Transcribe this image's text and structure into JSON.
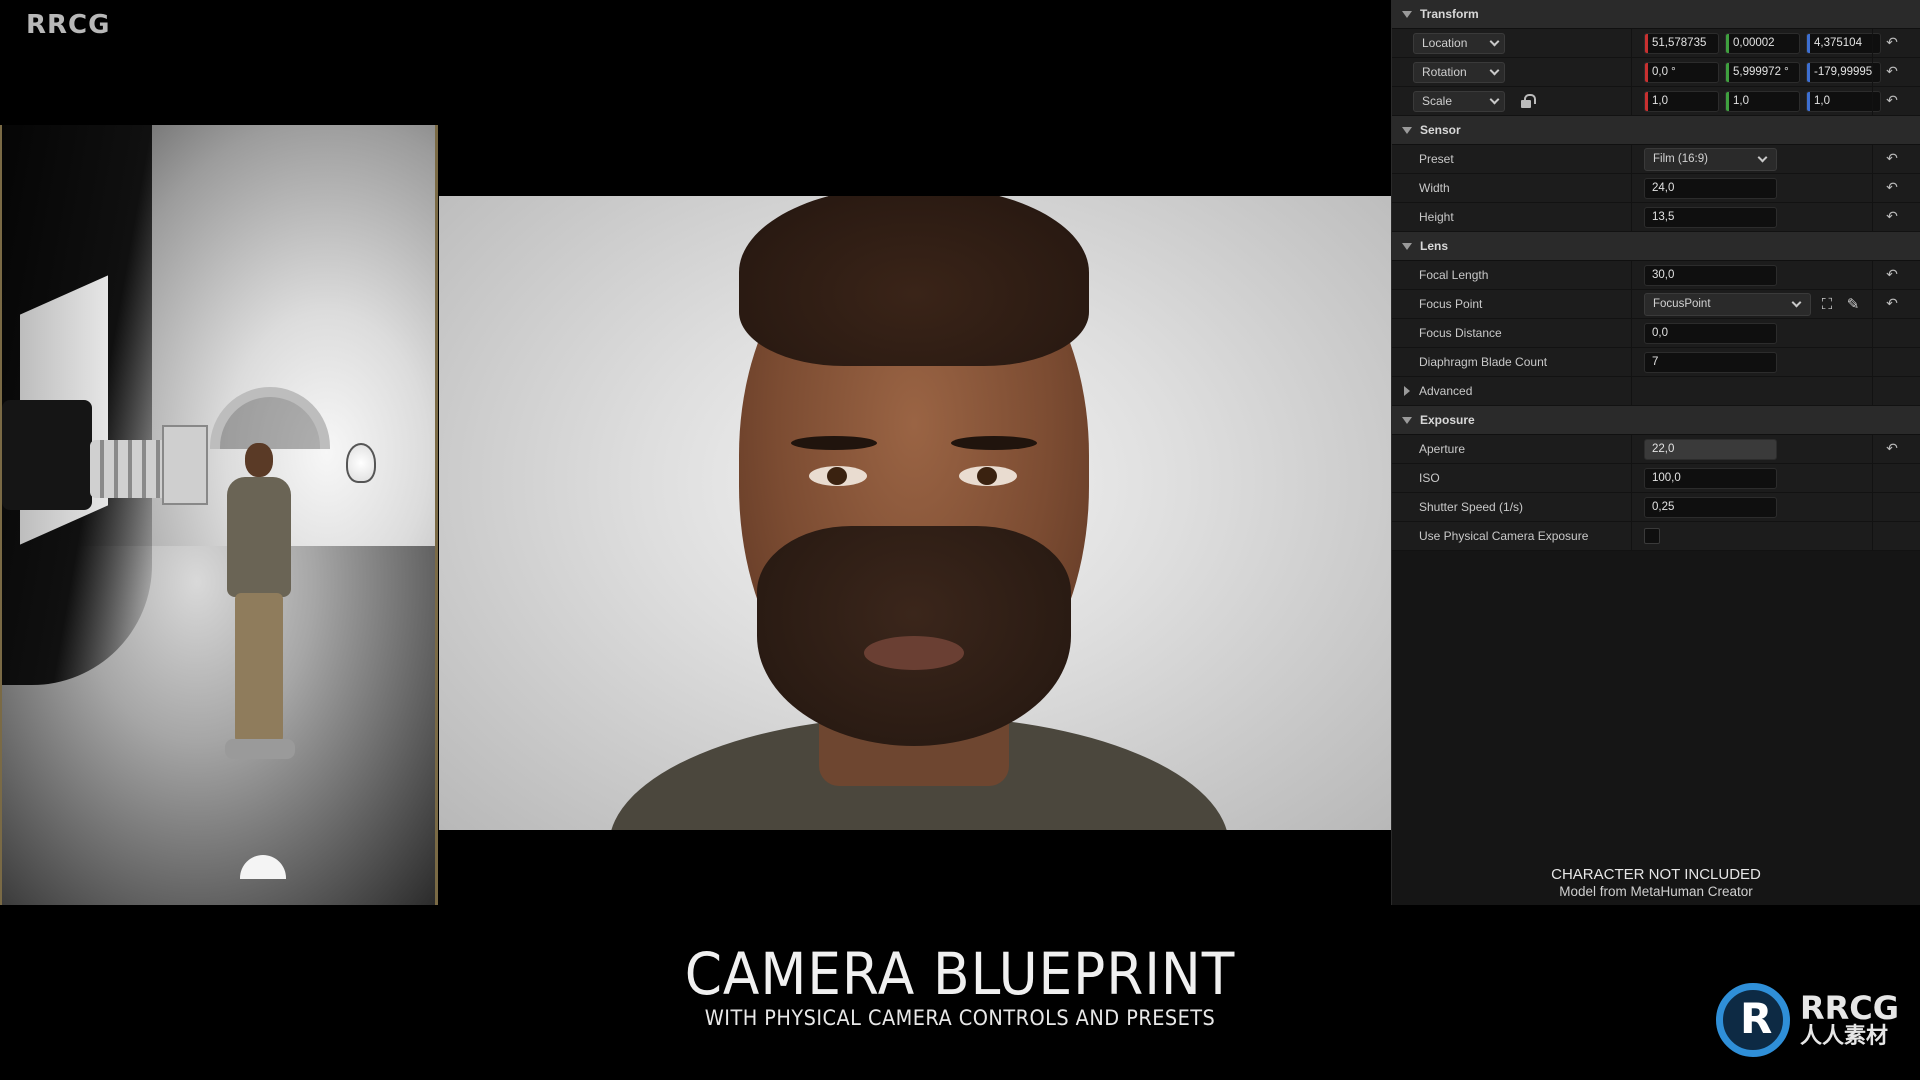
{
  "corner_logo": "RRCG",
  "details": {
    "transform": {
      "title": "Transform",
      "location": {
        "label": "Location",
        "x": "51,578735",
        "y": "0,00002",
        "z": "4,375104"
      },
      "rotation": {
        "label": "Rotation",
        "x": "0,0 °",
        "y": "5,999972 °",
        "z": "-179,99995"
      },
      "scale": {
        "label": "Scale",
        "x": "1,0",
        "y": "1,0",
        "z": "1,0"
      }
    },
    "sensor": {
      "title": "Sensor",
      "preset_label": "Preset",
      "preset_value": "Film (16:9)",
      "width_label": "Width",
      "width_value": "24,0",
      "height_label": "Height",
      "height_value": "13,5"
    },
    "lens": {
      "title": "Lens",
      "focal_length_label": "Focal Length",
      "focal_length_value": "30,0",
      "focus_point_label": "Focus Point",
      "focus_point_value": "FocusPoint",
      "focus_distance_label": "Focus Distance",
      "focus_distance_value": "0,0",
      "blade_count_label": "Diaphragm Blade Count",
      "blade_count_value": "7"
    },
    "advanced": {
      "title": "Advanced"
    },
    "exposure": {
      "title": "Exposure",
      "aperture_label": "Aperture",
      "aperture_value": "22,0",
      "iso_label": "ISO",
      "iso_value": "100,0",
      "shutter_label": "Shutter Speed (1/s)",
      "shutter_value": "0,25",
      "physical_label": "Use Physical Camera Exposure",
      "physical_checked": false
    }
  },
  "notice": {
    "line1": "CHARACTER NOT INCLUDED",
    "line2": "Model from MetaHuman Creator"
  },
  "title": {
    "main": "CAMERA BLUEPRINT",
    "sub": "WITH PHYSICAL CAMERA CONTROLS AND PRESETS"
  },
  "brand": {
    "name": "RRCG",
    "cn": "人人素材"
  },
  "icons": {
    "reset": "reset-arrow-icon",
    "lock": "lock-icon",
    "focus_picker": "focus-frame-icon",
    "eyedropper": "eyedropper-icon"
  },
  "colors": {
    "axis_x": "#c83030",
    "axis_y": "#3fa03f",
    "axis_z": "#3d6fd1",
    "brand_blue": "#2f8fd8"
  }
}
